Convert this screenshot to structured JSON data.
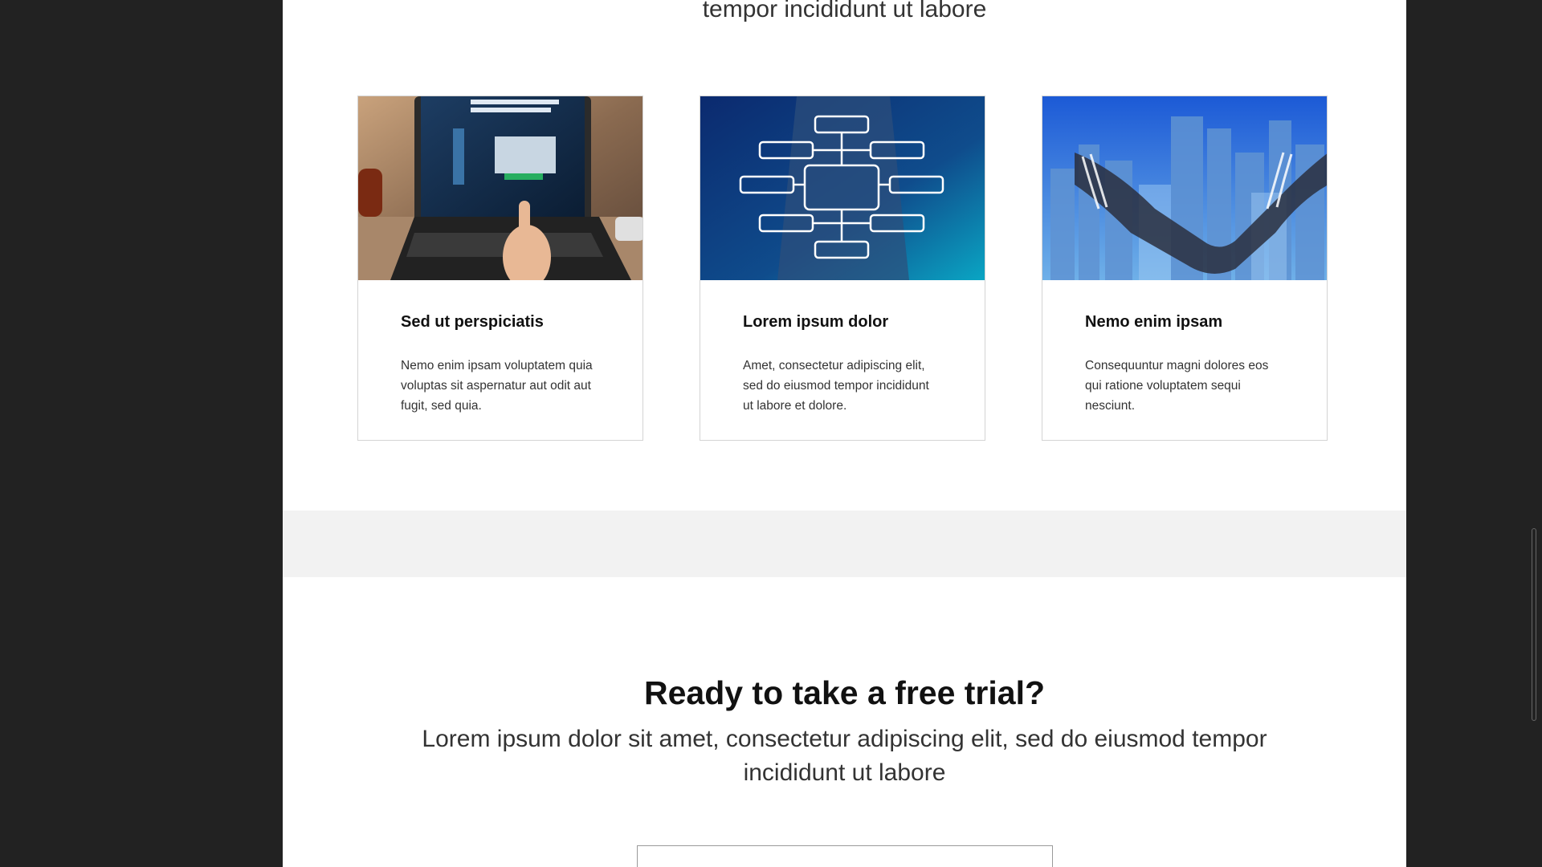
{
  "page": {
    "top_subtitle": "tempor incididunt ut labore"
  },
  "cards": [
    {
      "image": "laptop-revenue-photo",
      "title": "Sed ut perspiciatis",
      "text": "Nemo enim ipsam voluptatem quia voluptas sit aspernatur aut odit aut fugit, sed quia."
    },
    {
      "image": "flowchart-businessman-photo",
      "title": "Lorem ipsum dolor",
      "text": "Amet, consectetur adipiscing elit, sed do eiusmod tempor incididunt ut labore et dolore."
    },
    {
      "image": "handshake-city-photo",
      "title": "Nemo enim ipsam",
      "text": "Consequuntur magni dolores eos qui ratione voluptatem sequi nesciunt."
    }
  ],
  "cta": {
    "title": "Ready to take a free trial?",
    "subtitle": "Lorem ipsum dolor sit amet, consectetur adipiscing elit, sed do eiusmod tempor incididunt ut labore",
    "input_value": ""
  },
  "colors": {
    "outer_background": "#222222",
    "page_background": "#ffffff",
    "band_background": "#f2f2f2",
    "card_border": "#d4d4d4"
  }
}
